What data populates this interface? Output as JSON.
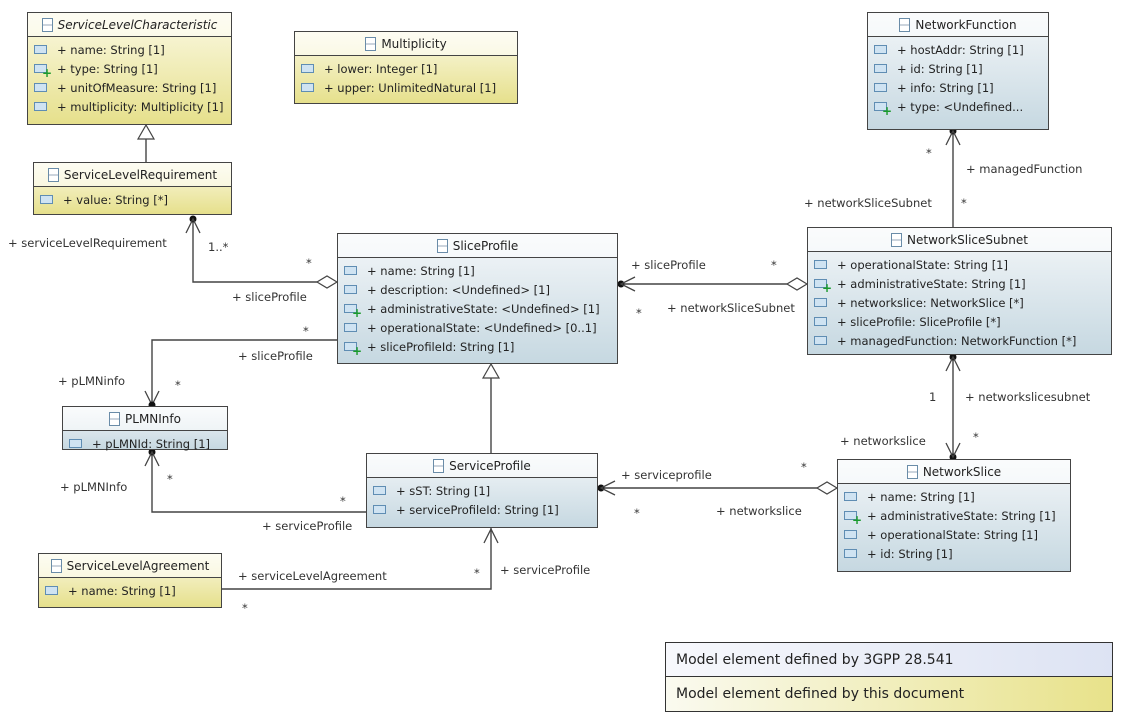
{
  "classes": [
    {
      "id": "slc",
      "name": "ServiceLevelCharacteristic",
      "italic": true,
      "color": "yellow",
      "attributes": [
        {
          "text": "+ name: String [1]",
          "icon": "attribute-icon"
        },
        {
          "text": "+ type: String [1]",
          "icon": "attribute-plus-icon"
        },
        {
          "text": "+ unitOfMeasure: String [1]",
          "icon": "attribute-icon"
        },
        {
          "text": "+ multiplicity: Multiplicity [1]",
          "icon": "attribute-icon"
        }
      ]
    },
    {
      "id": "mult",
      "name": "Multiplicity",
      "italic": false,
      "color": "yellow",
      "attributes": [
        {
          "text": "+ lower: Integer [1]",
          "icon": "attribute-icon"
        },
        {
          "text": "+ upper: UnlimitedNatural [1]",
          "icon": "attribute-icon"
        }
      ]
    },
    {
      "id": "slr",
      "name": "ServiceLevelRequirement",
      "italic": false,
      "color": "yellow",
      "attributes": [
        {
          "text": "+ value: String [*]",
          "icon": "attribute-icon"
        }
      ]
    },
    {
      "id": "sp",
      "name": "SliceProfile",
      "italic": false,
      "color": "blue",
      "attributes": [
        {
          "text": "+ name: String [1]",
          "icon": "attribute-icon"
        },
        {
          "text": "+ description: <Undefined> [1]",
          "icon": "attribute-icon"
        },
        {
          "text": "+ administrativeState: <Undefined> [1]",
          "icon": "attribute-plus-icon"
        },
        {
          "text": "+ operationalState: <Undefined> [0..1]",
          "icon": "attribute-icon"
        },
        {
          "text": "+ sliceProfileId: String [1]",
          "icon": "attribute-plus-icon"
        }
      ]
    },
    {
      "id": "nf",
      "name": "NetworkFunction",
      "italic": false,
      "color": "blue",
      "attributes": [
        {
          "text": "+ hostAddr: String [1]",
          "icon": "attribute-icon"
        },
        {
          "text": "+ id: String [1]",
          "icon": "attribute-icon"
        },
        {
          "text": "+ info: String [1]",
          "icon": "attribute-icon"
        },
        {
          "text": "+ type: <Undefined...",
          "icon": "attribute-plus-icon"
        }
      ]
    },
    {
      "id": "nss",
      "name": "NetworkSliceSubnet",
      "italic": false,
      "color": "blue",
      "attributes": [
        {
          "text": "+ operationalState: String [1]",
          "icon": "attribute-icon"
        },
        {
          "text": "+ administrativeState: String [1]",
          "icon": "attribute-plus-icon"
        },
        {
          "text": "+ networkslice: NetworkSlice [*]",
          "icon": "attribute-icon"
        },
        {
          "text": "+ sliceProfile: SliceProfile [*]",
          "icon": "attribute-icon"
        },
        {
          "text": "+ managedFunction: NetworkFunction [*]",
          "icon": "attribute-icon"
        }
      ]
    },
    {
      "id": "plmn",
      "name": "PLMNInfo",
      "italic": false,
      "color": "blue",
      "attributes": [
        {
          "text": "+ pLMNId: String [1]",
          "icon": "attribute-icon"
        }
      ]
    },
    {
      "id": "svp",
      "name": "ServiceProfile",
      "italic": false,
      "color": "blue",
      "attributes": [
        {
          "text": "+ sST: String [1]",
          "icon": "attribute-icon"
        },
        {
          "text": "+ serviceProfileId: String [1]",
          "icon": "attribute-icon"
        }
      ]
    },
    {
      "id": "ns",
      "name": "NetworkSlice",
      "italic": false,
      "color": "blue",
      "attributes": [
        {
          "text": "+ name: String [1]",
          "icon": "attribute-icon"
        },
        {
          "text": "+ administrativeState: String [1]",
          "icon": "attribute-plus-icon"
        },
        {
          "text": "+ operationalState: String [1]",
          "icon": "attribute-icon"
        },
        {
          "text": "+ id: String [1]",
          "icon": "attribute-icon"
        }
      ]
    },
    {
      "id": "sla",
      "name": "ServiceLevelAgreement",
      "italic": false,
      "color": "yellow",
      "attributes": [
        {
          "text": "+ name: String [1]",
          "icon": "attribute-icon"
        }
      ]
    }
  ],
  "labels": [
    "+ serviceLevelRequirement",
    "1..*",
    "*",
    "+ sliceProfile",
    "*",
    "+ sliceProfile",
    "+ pLMNinfo",
    "*",
    "+ pLMNInfo",
    "*",
    "*",
    "+ serviceProfile",
    "+ serviceLevelAgreement",
    "*",
    "+ serviceProfile",
    "*",
    "+ sliceProfile",
    "*",
    "*",
    "+ networkSliceSubnet",
    "*",
    "+ managedFunction",
    "+ networkSliceSubnet",
    "*",
    "1",
    "+ networkslicesubnet",
    "+ networkslice",
    "*",
    "+ serviceprofile",
    "*",
    "*",
    "+ networkslice"
  ],
  "legend": {
    "row1": "Model element defined by 3GPP 28.541",
    "row2": "Model element defined by this document",
    "row1_color": "#dde3f3",
    "row2_color": "#e8e28a"
  }
}
